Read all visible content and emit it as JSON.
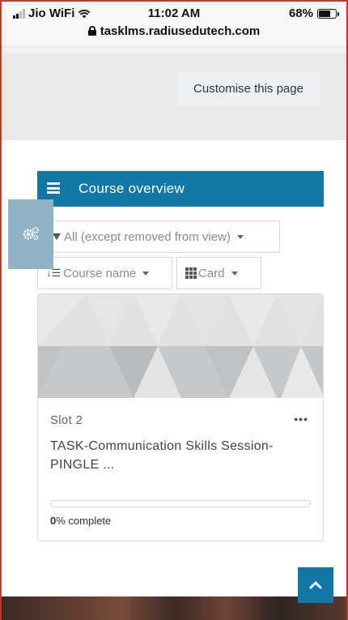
{
  "status_bar": {
    "carrier": "Jio WiFi",
    "time": "11:02 AM",
    "battery": "68%",
    "url": "tasklms.radiusedutech.com"
  },
  "header": {
    "customise_label": "Customise this page"
  },
  "course_overview": {
    "title": "Course overview",
    "filter_label": "All (except removed from view)",
    "sort_label": "Course name",
    "view_label": "Card"
  },
  "course_card": {
    "category": "Slot 2",
    "title": "TASK-Communication Skills Session-PINGLE ...",
    "progress_percent": 0,
    "progress_value": "0",
    "progress_suffix": "% complete"
  },
  "colors": {
    "brand_blue": "#1177a6",
    "settings_block": "#8fb3c2"
  },
  "icons": [
    "signal-icon",
    "wifi-icon",
    "battery-icon",
    "lock-icon",
    "hamburger-icon",
    "gear-icon",
    "filter-icon",
    "sort-icon",
    "grid-icon",
    "more-icon",
    "chevron-up-icon"
  ]
}
